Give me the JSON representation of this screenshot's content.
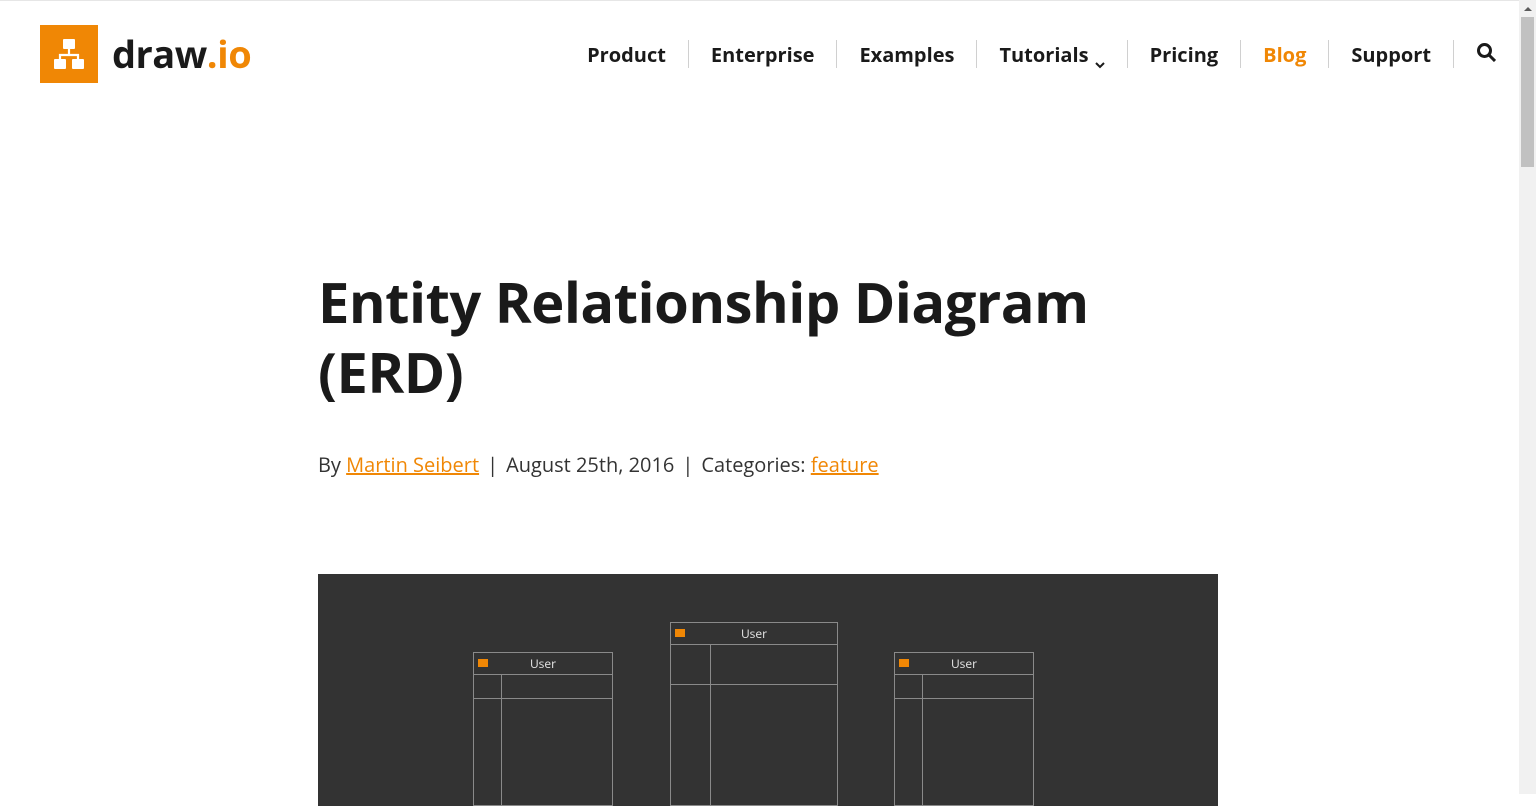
{
  "brand": {
    "name_part1": "draw",
    "name_dot": ".",
    "name_part2": "io"
  },
  "nav": {
    "items": [
      {
        "label": "Product",
        "active": false,
        "hasDropdown": false
      },
      {
        "label": "Enterprise",
        "active": false,
        "hasDropdown": false
      },
      {
        "label": "Examples",
        "active": false,
        "hasDropdown": false
      },
      {
        "label": "Tutorials",
        "active": false,
        "hasDropdown": true
      },
      {
        "label": "Pricing",
        "active": false,
        "hasDropdown": false
      },
      {
        "label": "Blog",
        "active": true,
        "hasDropdown": false
      },
      {
        "label": "Support",
        "active": false,
        "hasDropdown": false
      }
    ]
  },
  "article": {
    "title": "Entity Relationship Diagram (ERD)",
    "by_label": "By ",
    "author": "Martin Seibert",
    "date": "August 25th, 2016",
    "categories_label": "Categories: ",
    "category": "feature"
  },
  "hero": {
    "entities": [
      {
        "label": "User"
      },
      {
        "label": "User"
      },
      {
        "label": "User"
      }
    ]
  },
  "colors": {
    "accent": "#f08705",
    "heroBg": "#333333"
  }
}
